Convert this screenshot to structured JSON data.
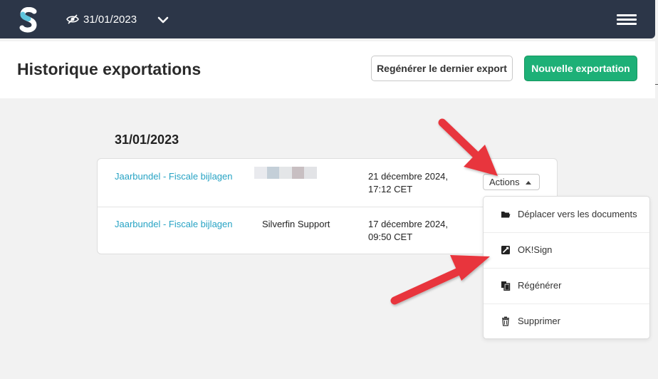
{
  "topbar": {
    "date": "31/01/2023"
  },
  "header": {
    "title": "Historique exportations",
    "regenerate_label": "Regénérer le dernier export",
    "new_export_label": "Nouvelle exportation"
  },
  "section": {
    "date": "31/01/2023"
  },
  "rows": [
    {
      "name": "Jaarbundel - Fiscale bijlagen",
      "user": "",
      "date_line1": "21 décembre 2024,",
      "date_line2": "17:12 CET",
      "actions_label": "Actions"
    },
    {
      "name": "Jaarbundel - Fiscale bijlagen",
      "user": "Silverfin Support",
      "date_line1": "17 décembre 2024,",
      "date_line2": "09:50 CET"
    }
  ],
  "menu": {
    "items": [
      {
        "label": "Déplacer vers les documents",
        "icon": "folder-icon"
      },
      {
        "label": "OK!Sign",
        "icon": "sign-icon"
      },
      {
        "label": "Régénérer",
        "icon": "copy-icon"
      },
      {
        "label": "Supprimer",
        "icon": "trash-icon"
      }
    ]
  },
  "colors": {
    "topbar": "#2c3648",
    "primary_green": "#1db077",
    "link": "#27a3c4",
    "annotation_arrow": "#e8363d"
  }
}
